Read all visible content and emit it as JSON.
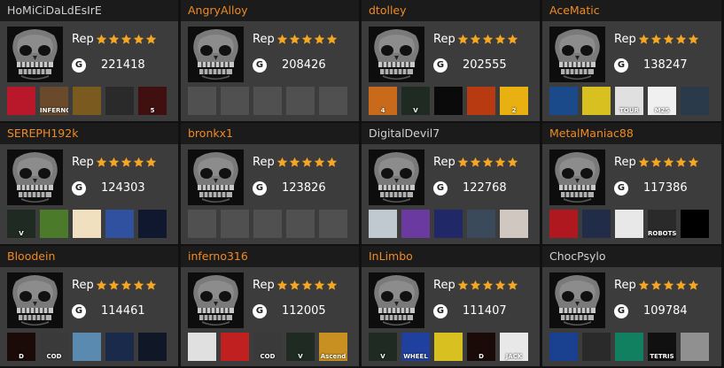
{
  "colors": {
    "card_bg": "#3c3c3c",
    "header_bg": "#1b1b1b",
    "name_orange": "#f08a24",
    "name_gray": "#d0d0d0",
    "star": "#f5a623",
    "empty_tile": "#505050"
  },
  "icons": {
    "avatar": "skull-avatar",
    "star": "star-icon",
    "gamerscore": "g-gamerscore-icon"
  },
  "cards": [
    {
      "name": "HoMiCiDaLdEsIrE",
      "name_color": "gray",
      "rep_label": "Rep",
      "rep_stars": 5,
      "g_label": "G",
      "score": "221418",
      "games": [
        {
          "abbr": "",
          "bg": "#b8182a"
        },
        {
          "abbr": "INFERNO",
          "bg": "#6a4a2a"
        },
        {
          "abbr": "",
          "bg": "#7b5a20"
        },
        {
          "abbr": "",
          "bg": "#2a2a2a"
        },
        {
          "abbr": "5",
          "bg": "#401010"
        }
      ]
    },
    {
      "name": "AngryAlloy",
      "name_color": "orange",
      "rep_label": "Rep",
      "rep_stars": 5,
      "g_label": "G",
      "score": "208426",
      "games": [
        {
          "abbr": "",
          "bg": "empty"
        },
        {
          "abbr": "",
          "bg": "empty"
        },
        {
          "abbr": "",
          "bg": "empty"
        },
        {
          "abbr": "",
          "bg": "empty"
        },
        {
          "abbr": "",
          "bg": "empty"
        }
      ]
    },
    {
      "name": "dtolley",
      "name_color": "orange",
      "rep_label": "Rep",
      "rep_stars": 5,
      "g_label": "G",
      "score": "202555",
      "games": [
        {
          "abbr": "4",
          "bg": "#c86a1a"
        },
        {
          "abbr": "V",
          "bg": "#1e2a22"
        },
        {
          "abbr": "",
          "bg": "#0a0a0a"
        },
        {
          "abbr": "",
          "bg": "#b83a10"
        },
        {
          "abbr": "2",
          "bg": "#e8b010"
        }
      ]
    },
    {
      "name": "AceMatic",
      "name_color": "orange",
      "rep_label": "Rep",
      "rep_stars": 5,
      "g_label": "G",
      "score": "138247",
      "games": [
        {
          "abbr": "",
          "bg": "#1a4a8a"
        },
        {
          "abbr": "",
          "bg": "#d8c020"
        },
        {
          "abbr": "TOUR",
          "bg": "#e0e0e0"
        },
        {
          "abbr": "M25",
          "bg": "#f0f0f0"
        },
        {
          "abbr": "",
          "bg": "#2a3a4a"
        }
      ]
    },
    {
      "name": "SEREPH192k",
      "name_color": "orange",
      "rep_label": "Rep",
      "rep_stars": 5,
      "g_label": "G",
      "score": "124303",
      "games": [
        {
          "abbr": "V",
          "bg": "#1e2a22"
        },
        {
          "abbr": "",
          "bg": "#4a7a2a"
        },
        {
          "abbr": "",
          "bg": "#f0e0c0"
        },
        {
          "abbr": "",
          "bg": "#3050a0"
        },
        {
          "abbr": "",
          "bg": "#101830"
        }
      ]
    },
    {
      "name": "bronkx1",
      "name_color": "orange",
      "rep_label": "Rep",
      "rep_stars": 5,
      "g_label": "G",
      "score": "123826",
      "games": [
        {
          "abbr": "",
          "bg": "empty"
        },
        {
          "abbr": "",
          "bg": "empty"
        },
        {
          "abbr": "",
          "bg": "empty"
        },
        {
          "abbr": "",
          "bg": "empty"
        },
        {
          "abbr": "",
          "bg": "empty"
        }
      ]
    },
    {
      "name": "DigitalDevil7",
      "name_color": "gray",
      "rep_label": "Rep",
      "rep_stars": 5,
      "g_label": "G",
      "score": "122768",
      "games": [
        {
          "abbr": "",
          "bg": "#c0c8d0"
        },
        {
          "abbr": "",
          "bg": "#6a3aa0"
        },
        {
          "abbr": "",
          "bg": "#202868"
        },
        {
          "abbr": "",
          "bg": "#3a4a5a"
        },
        {
          "abbr": "",
          "bg": "#d0c8c0"
        }
      ]
    },
    {
      "name": "MetalManiac88",
      "name_color": "orange",
      "rep_label": "Rep",
      "rep_stars": 5,
      "g_label": "G",
      "score": "117386",
      "games": [
        {
          "abbr": "",
          "bg": "#b01820"
        },
        {
          "abbr": "",
          "bg": "#202c48"
        },
        {
          "abbr": "",
          "bg": "#e8e8e8"
        },
        {
          "abbr": "ROBOTS",
          "bg": "#2a2a2a"
        },
        {
          "abbr": "",
          "bg": "#000000"
        }
      ]
    },
    {
      "name": "Bloodein",
      "name_color": "orange",
      "rep_label": "Rep",
      "rep_stars": 5,
      "g_label": "G",
      "score": "114461",
      "games": [
        {
          "abbr": "D",
          "bg": "#1a0a08"
        },
        {
          "abbr": "COD",
          "bg": "#3a3a3a"
        },
        {
          "abbr": "",
          "bg": "#5a8ab0"
        },
        {
          "abbr": "",
          "bg": "#1a2a4a"
        },
        {
          "abbr": "",
          "bg": "#101828"
        }
      ]
    },
    {
      "name": "inferno316",
      "name_color": "orange",
      "rep_label": "Rep",
      "rep_stars": 5,
      "g_label": "G",
      "score": "112005",
      "games": [
        {
          "abbr": "",
          "bg": "#e0e0e0"
        },
        {
          "abbr": "",
          "bg": "#c02020"
        },
        {
          "abbr": "COD",
          "bg": "#3a3a3a"
        },
        {
          "abbr": "V",
          "bg": "#1e2a22"
        },
        {
          "abbr": "Ascend",
          "bg": "#c89020"
        }
      ]
    },
    {
      "name": "InLimbo",
      "name_color": "orange",
      "rep_label": "Rep",
      "rep_stars": 5,
      "g_label": "G",
      "score": "111407",
      "games": [
        {
          "abbr": "V",
          "bg": "#1e2a22"
        },
        {
          "abbr": "WHEEL",
          "bg": "#2040a0"
        },
        {
          "abbr": "",
          "bg": "#d8c020"
        },
        {
          "abbr": "D",
          "bg": "#1a0a08"
        },
        {
          "abbr": "JACK",
          "bg": "#e8e8e8"
        }
      ]
    },
    {
      "name": "ChocPsylo",
      "name_color": "gray",
      "rep_label": "Rep",
      "rep_stars": 5,
      "g_label": "G",
      "score": "109784",
      "games": [
        {
          "abbr": "",
          "bg": "#1a4090"
        },
        {
          "abbr": "",
          "bg": "#2a2a2a"
        },
        {
          "abbr": "",
          "bg": "#108060"
        },
        {
          "abbr": "TETRIS",
          "bg": "#101010"
        },
        {
          "abbr": "",
          "bg": "#909090"
        }
      ]
    }
  ]
}
